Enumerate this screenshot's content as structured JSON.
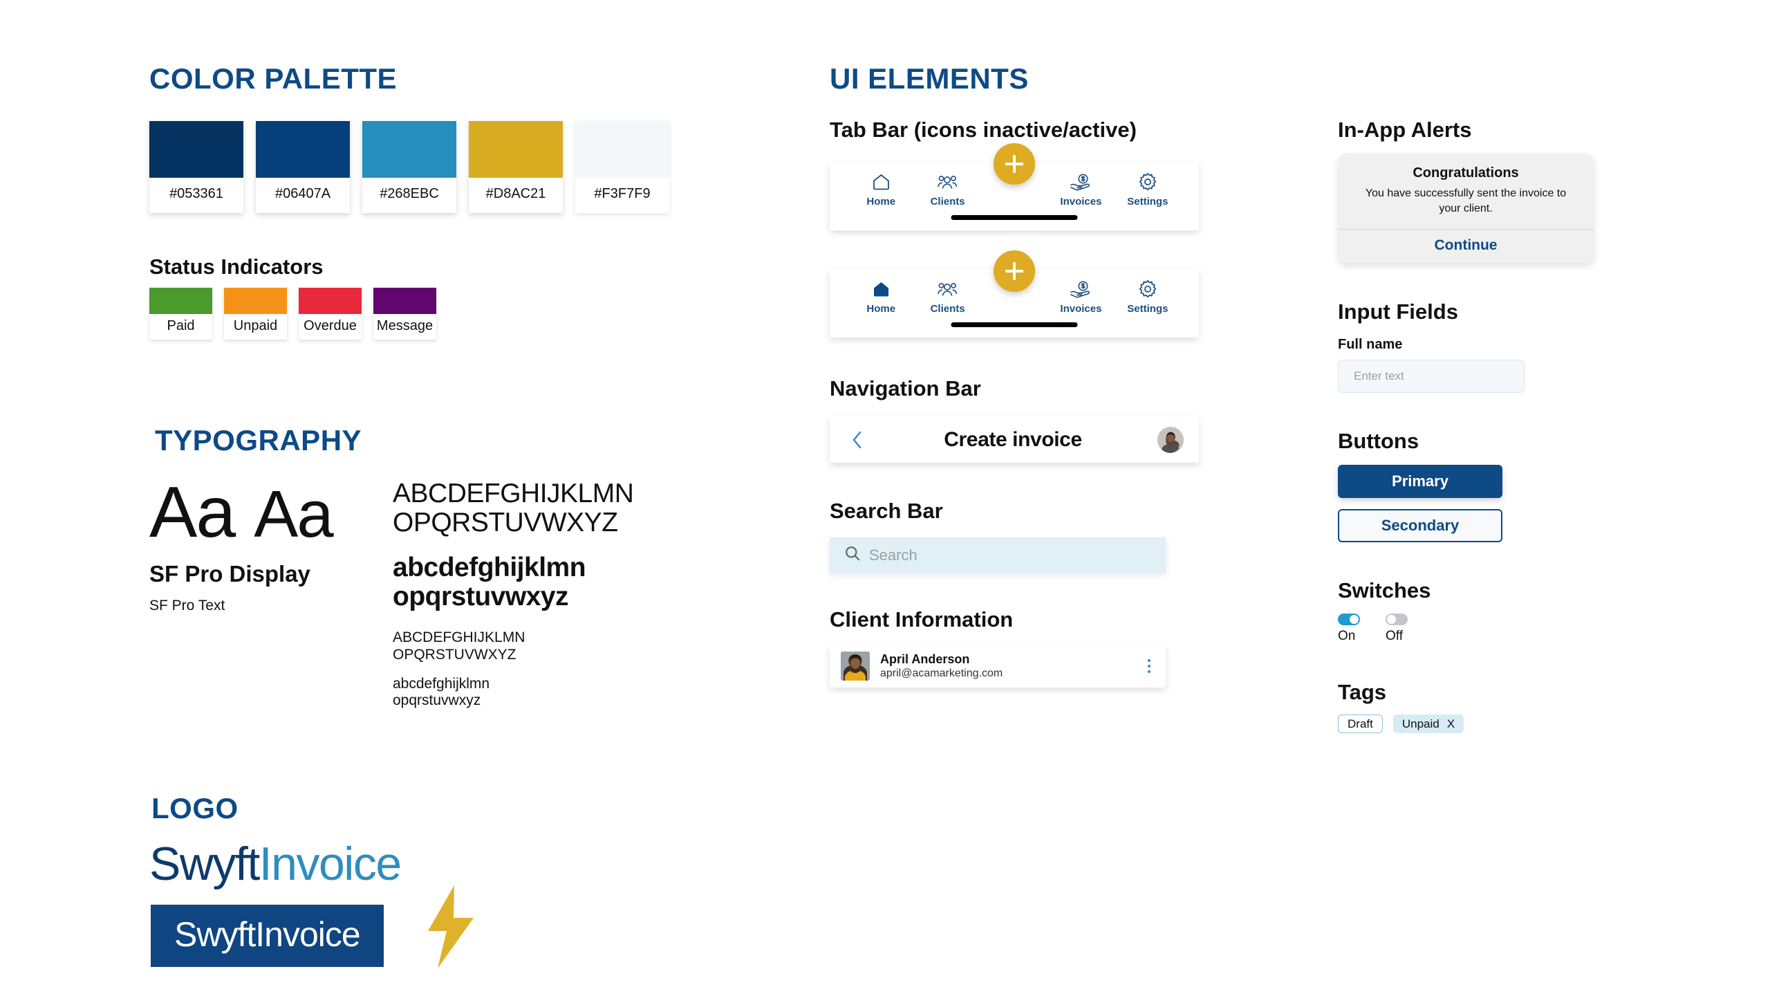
{
  "colors": {
    "brand_navy": "#053361",
    "brand_blue": "#06407A",
    "brand_sky": "#268EBC",
    "brand_gold": "#D8AC21",
    "brand_offwhite": "#F3F7F9"
  },
  "color_palette": {
    "heading": "Color Palette",
    "swatches": [
      {
        "hex": "#053361"
      },
      {
        "hex": "#06407A"
      },
      {
        "hex": "#268EBC"
      },
      {
        "hex": "#D8AC21"
      },
      {
        "hex": "#F3F7F9"
      }
    ]
  },
  "status_indicators": {
    "heading": "Status Indicators",
    "items": [
      {
        "label": "Paid",
        "hex": "#4A9A2E"
      },
      {
        "label": "Unpaid",
        "hex": "#F79219"
      },
      {
        "label": "Overdue",
        "hex": "#E8293C"
      },
      {
        "label": "Message",
        "hex": "#63056E"
      }
    ]
  },
  "typography": {
    "heading": "Typography",
    "aa_display": "Aa",
    "aa_text": "Aa",
    "face_display": "SF Pro Display",
    "face_text": "SF Pro Text",
    "sample_large_upper_1": "ABCDEFGHIJKLMN",
    "sample_large_upper_2": "OPQRSTUVWXYZ",
    "sample_large_lower_1": "abcdefghijklmn",
    "sample_large_lower_2": "opqrstuvwxyz",
    "sample_small_upper_1": "ABCDEFGHIJKLMN",
    "sample_small_upper_2": "OPQRSTUVWXYZ",
    "sample_small_lower_1": "abcdefghijklmn",
    "sample_small_lower_2": "opqrstuvwxyz"
  },
  "logo": {
    "heading": "Logo",
    "word_1": "Swyft",
    "word_2": "Invoice",
    "block_word_1": "Swyft",
    "block_word_2": "Invoice",
    "mark": "lightning-bolt"
  },
  "ui_elements": {
    "heading": "UI Elements",
    "tab_bar": {
      "heading": "Tab Bar (icons inactive/active)",
      "fab_label": "+",
      "inactive": {
        "tabs": [
          {
            "label": "Home",
            "icon": "home-icon",
            "active": false
          },
          {
            "label": "Clients",
            "icon": "clients-icon",
            "active": false
          },
          {
            "label": "Invoices",
            "icon": "invoices-icon",
            "active": false
          },
          {
            "label": "Settings",
            "icon": "settings-icon",
            "active": false
          }
        ]
      },
      "active": {
        "tabs": [
          {
            "label": "Home",
            "icon": "home-icon",
            "active": true
          },
          {
            "label": "Clients",
            "icon": "clients-icon",
            "active": false
          },
          {
            "label": "Invoices",
            "icon": "invoices-icon",
            "active": false
          },
          {
            "label": "Settings",
            "icon": "settings-icon",
            "active": false
          }
        ]
      }
    },
    "navigation_bar": {
      "heading": "Navigation Bar",
      "title": "Create invoice",
      "back_icon": "chevron-left-icon",
      "avatar": "user-avatar"
    },
    "search_bar": {
      "heading": "Search Bar",
      "placeholder": "Search",
      "icon": "search-icon"
    },
    "client_information": {
      "heading": "Client Information",
      "name": "April Anderson",
      "email": "april@acamarketing.com",
      "menu_icon": "kebab-menu-icon"
    }
  },
  "alerts": {
    "heading": "In-App Alerts",
    "title": "Congratulations",
    "message": "You have successfully sent the invoice to your client.",
    "button": "Continue"
  },
  "input_fields": {
    "heading": "Input Fields",
    "label": "Full name",
    "placeholder": "Enter text",
    "value": ""
  },
  "buttons": {
    "heading": "Buttons",
    "primary": "Primary",
    "secondary": "Secondary"
  },
  "switches": {
    "heading": "Switches",
    "items": [
      {
        "label": "On",
        "state": "on"
      },
      {
        "label": "Off",
        "state": "off"
      }
    ]
  },
  "tags": {
    "heading": "Tags",
    "items": [
      {
        "label": "Draft",
        "style": "outline",
        "removable": false,
        "remove_label": ""
      },
      {
        "label": "Unpaid",
        "style": "filled",
        "removable": true,
        "remove_label": "X"
      }
    ]
  }
}
